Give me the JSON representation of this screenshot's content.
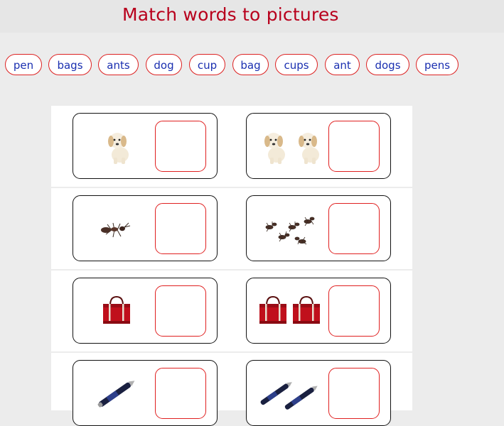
{
  "title": "Match words to pictures",
  "words": [
    "pen",
    "bags",
    "ants",
    "dog",
    "cup",
    "bag",
    "cups",
    "ant",
    "dogs",
    "pens"
  ],
  "cards": [
    {
      "picture": "dog-picture",
      "count": 1
    },
    {
      "picture": "dog-picture",
      "count": 2
    },
    {
      "picture": "ant-picture",
      "count": 1
    },
    {
      "picture": "ant-picture",
      "count": 5
    },
    {
      "picture": "bag-picture",
      "count": 1
    },
    {
      "picture": "bag-picture",
      "count": 2
    },
    {
      "picture": "pen-picture",
      "count": 1
    },
    {
      "picture": "pen-picture",
      "count": 2
    }
  ],
  "colors": {
    "title": "#b8001c",
    "word_text": "#1a2fb0",
    "word_border": "#dd2222",
    "slot_border": "#e02020",
    "background": "#ececec"
  }
}
